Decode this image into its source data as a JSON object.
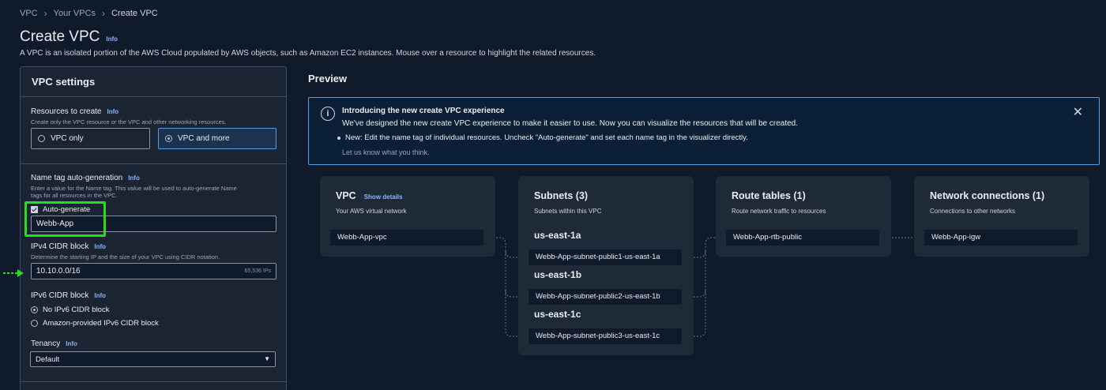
{
  "breadcrumb": {
    "items": [
      "VPC",
      "Your VPCs",
      "Create VPC"
    ]
  },
  "page": {
    "title": "Create VPC",
    "info": "Info",
    "subtitle": "A VPC is an isolated portion of the AWS Cloud populated by AWS objects, such as Amazon EC2 instances. Mouse over a resource to highlight the related resources."
  },
  "settings": {
    "title": "VPC settings",
    "resources": {
      "label": "Resources to create",
      "info": "Info",
      "desc": "Create only the VPC resource or the VPC and other networking resources.",
      "options": [
        "VPC only",
        "VPC and more"
      ],
      "selected": "VPC and more"
    },
    "name_tag": {
      "label": "Name tag auto-generation",
      "info": "Info",
      "desc_line1": "Enter a value for the Name tag. This value will be used to auto-generate Name",
      "desc_line2": "tags for all resources in the VPC.",
      "checkbox_label": "Auto-generate",
      "checked": true,
      "value": "Webb-App"
    },
    "ipv4": {
      "label": "IPv4 CIDR block",
      "info": "Info",
      "desc": "Determine the starting IP and the size of your VPC using CIDR notation.",
      "value": "10.10.0.0/16",
      "hint": "65,536 IPs"
    },
    "ipv6": {
      "label": "IPv6 CIDR block",
      "info": "Info",
      "options": [
        "No IPv6 CIDR block",
        "Amazon-provided IPv6 CIDR block"
      ],
      "selected": "No IPv6 CIDR block"
    },
    "tenancy": {
      "label": "Tenancy",
      "info": "Info",
      "value": "Default"
    }
  },
  "preview": {
    "title": "Preview",
    "banner": {
      "title": "Introducing the new create VPC experience",
      "desc": "We've designed the new create VPC experience to make it easier to use. Now you can visualize the resources that will be created.",
      "bullet": "New: Edit the name tag of individual resources. Uncheck \"Auto-generate\" and set each name tag in the visualizer directly.",
      "footer": "Let us know what you think."
    },
    "vpc": {
      "title": "VPC",
      "show_details": "Show details",
      "subtitle": "Your AWS virtual network",
      "resource": "Webb-App-vpc"
    },
    "subnets": {
      "title": "Subnets (3)",
      "subtitle": "Subnets within this VPC",
      "azs": [
        {
          "name": "us-east-1a",
          "subnet": "Webb-App-subnet-public1-us-east-1a"
        },
        {
          "name": "us-east-1b",
          "subnet": "Webb-App-subnet-public2-us-east-1b"
        },
        {
          "name": "us-east-1c",
          "subnet": "Webb-App-subnet-public3-us-east-1c"
        }
      ]
    },
    "route_tables": {
      "title": "Route tables (1)",
      "subtitle": "Route network traffic to resources",
      "resource": "Webb-App-rtb-public"
    },
    "network": {
      "title": "Network connections (1)",
      "subtitle": "Connections to other networks",
      "resource": "Webb-App-igw"
    }
  },
  "colors": {
    "accent": "#539fe5",
    "highlight": "#22e01e",
    "background": "#0f1b2a"
  }
}
